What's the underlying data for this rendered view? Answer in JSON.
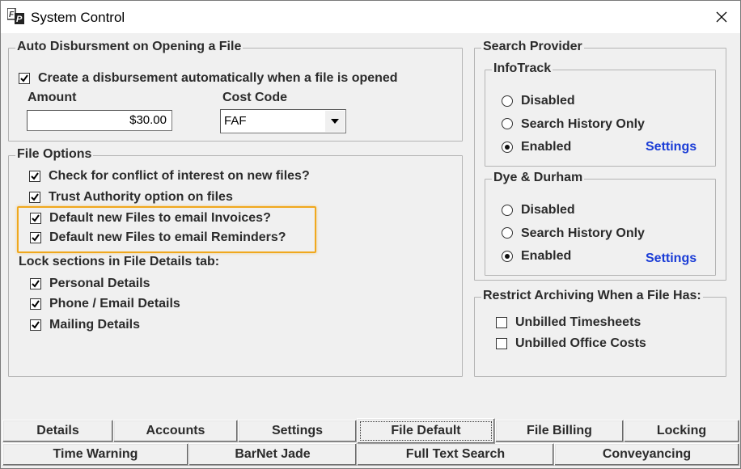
{
  "window": {
    "title": "System Control"
  },
  "auto_disbursement": {
    "title": "Auto Disbursment on Opening a File",
    "create_label": "Create a disbursement automatically when a file is opened",
    "create_checked": true,
    "amount_label": "Amount",
    "amount_value": "$30.00",
    "cost_code_label": "Cost Code",
    "cost_code_value": "FAF"
  },
  "file_options": {
    "title": "File Options",
    "options": [
      {
        "label": "Check for conflict of interest on new files?",
        "checked": true
      },
      {
        "label": "Trust Authority option on files",
        "checked": true
      },
      {
        "label": "Default new Files to email Invoices?",
        "checked": true
      },
      {
        "label": "Default new Files to email Reminders?",
        "checked": true
      }
    ],
    "lock_label": "Lock sections in File Details tab:",
    "lock_items": [
      {
        "label": "Personal Details",
        "checked": true
      },
      {
        "label": "Phone / Email Details",
        "checked": true
      },
      {
        "label": "Mailing Details",
        "checked": true
      }
    ]
  },
  "search_provider": {
    "title": "Search Provider",
    "infotrack": {
      "title": "InfoTrack",
      "options": [
        "Disabled",
        "Search History Only",
        "Enabled"
      ],
      "selected": "Enabled",
      "settings_label": "Settings"
    },
    "dye_durham": {
      "title": "Dye & Durham",
      "options": [
        "Disabled",
        "Search History Only",
        "Enabled"
      ],
      "selected": "Enabled",
      "settings_label": "Settings"
    }
  },
  "restrict_archiving": {
    "title": "Restrict Archiving When a File Has:",
    "items": [
      {
        "label": "Unbilled Timesheets",
        "checked": false
      },
      {
        "label": "Unbilled Office Costs",
        "checked": false
      }
    ]
  },
  "tabs": {
    "row1": [
      "Details",
      "Accounts",
      "Settings",
      "File Default",
      "File Billing",
      "Locking"
    ],
    "row2": [
      "Time Warning",
      "BarNet Jade",
      "Full Text Search",
      "Conveyancing"
    ],
    "active": "File Default"
  },
  "colors": {
    "highlight": "#f0a81e",
    "link": "#1a3cd6"
  }
}
